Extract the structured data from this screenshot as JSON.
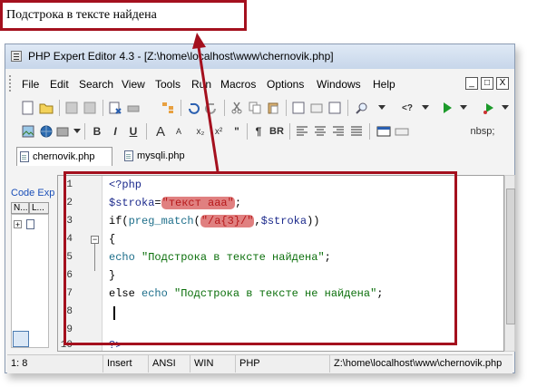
{
  "output_text": "Подстрока в тексте найдена",
  "window": {
    "title": "PHP Expert Editor 4.3 - [Z:\\home\\localhost\\www\\chernovik.php]",
    "controls": {
      "minimize": "_",
      "maximize": "□",
      "close": "X"
    }
  },
  "menu": [
    "File",
    "Edit",
    "Search",
    "View",
    "Tools",
    "Run",
    "Macros",
    "Options",
    "Windows",
    "Help"
  ],
  "toolbar2_labels": {
    "para": "¶",
    "br": "BR",
    "nbsp": "nbsp;",
    "bold": "B",
    "italic": "I",
    "underline": "U",
    "font_up": "A",
    "font_sup": "A",
    "sub": "x₂",
    "sup": "x²",
    "quote": "\"",
    "tag": "<?",
    "php_tag": "<"
  },
  "tabs": [
    {
      "label": "chernovik.php",
      "active": true
    },
    {
      "label": "mysqli.php",
      "active": false
    }
  ],
  "left_panel": {
    "title": "Code Exp",
    "col1": "N...",
    "col2": "L..."
  },
  "editor": {
    "line_numbers": [
      "1",
      "2",
      "3",
      "4",
      "5",
      "6",
      "7",
      "8",
      "9",
      "10"
    ],
    "lines": {
      "l1": "<?php",
      "l2_var": "$stroka",
      "l2_eq": "=",
      "l2_str": "\"текст ааа\"",
      "l2_end": ";",
      "l3_if": "if(",
      "l3_fn": "preg_match",
      "l3_open": "(",
      "l3_pat": "\"/а{3}/\"",
      "l3_comma": ",",
      "l3_var": "$stroka",
      "l3_close": "))",
      "l4": "{",
      "l5_echo": "echo",
      "l5_str": " \"Подстрока в тексте найдена\"",
      "l5_end": ";",
      "l6": "}",
      "l7_else": "else",
      "l7_echo": " echo",
      "l7_str": " \"Подстрока в тексте не найдена\"",
      "l7_end": ";",
      "l10": "?>"
    }
  },
  "statusbar": {
    "position": "1: 8",
    "mode": "Insert",
    "encoding": "ANSI",
    "lineend": "WIN",
    "syntax": "PHP",
    "path": "Z:\\home\\localhost\\www\\chernovik.php"
  },
  "colors": {
    "annotation": "#a4101e",
    "highlight": "#e08080",
    "keyword": "#1d6e8a",
    "string": "#0b6f0b"
  }
}
